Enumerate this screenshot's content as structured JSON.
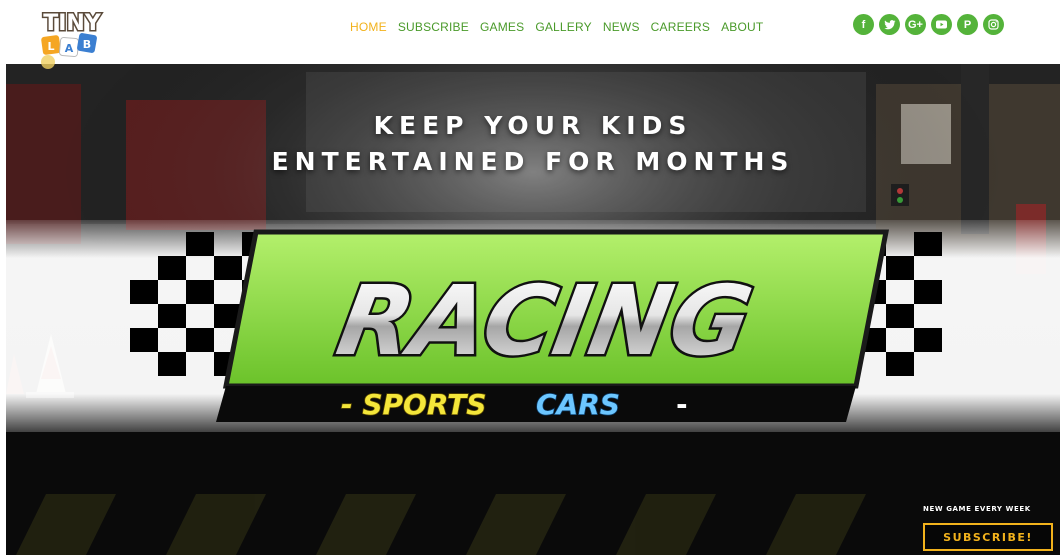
{
  "header": {
    "logo": {
      "line1": "TINY",
      "line2": "LAB"
    },
    "nav": [
      {
        "label": "HOME",
        "active": true
      },
      {
        "label": "SUBSCRIBE",
        "active": false
      },
      {
        "label": "GAMES",
        "active": false
      },
      {
        "label": "GALLERY",
        "active": false
      },
      {
        "label": "NEWS",
        "active": false
      },
      {
        "label": "CAREERS",
        "active": false
      },
      {
        "label": "ABOUT",
        "active": false
      }
    ],
    "social": [
      {
        "icon": "facebook-icon",
        "glyph": "f"
      },
      {
        "icon": "twitter-icon",
        "glyph": "t"
      },
      {
        "icon": "google-plus-icon",
        "glyph": "G+"
      },
      {
        "icon": "youtube-icon",
        "glyph": "▶"
      },
      {
        "icon": "pinterest-icon",
        "glyph": "P"
      },
      {
        "icon": "instagram-icon",
        "glyph": "◎"
      }
    ]
  },
  "hero": {
    "headline_line1": "KEEP YOUR KIDS",
    "headline_line2": "ENTERTAINED FOR MONTHS",
    "game_title": "RACING",
    "game_subtitle_a": "- SPORTS",
    "game_subtitle_b": "CARS",
    "game_subtitle_dash": "-",
    "cta_caption": "NEW GAME EVERY WEEK",
    "cta_label": "SUBSCRIBE!"
  },
  "colors": {
    "nav_green": "#4a9a2a",
    "nav_active": "#f2b21c",
    "social_green": "#54b33a",
    "cta_gold": "#f2b21c",
    "banner_green": "#8fd64a"
  }
}
